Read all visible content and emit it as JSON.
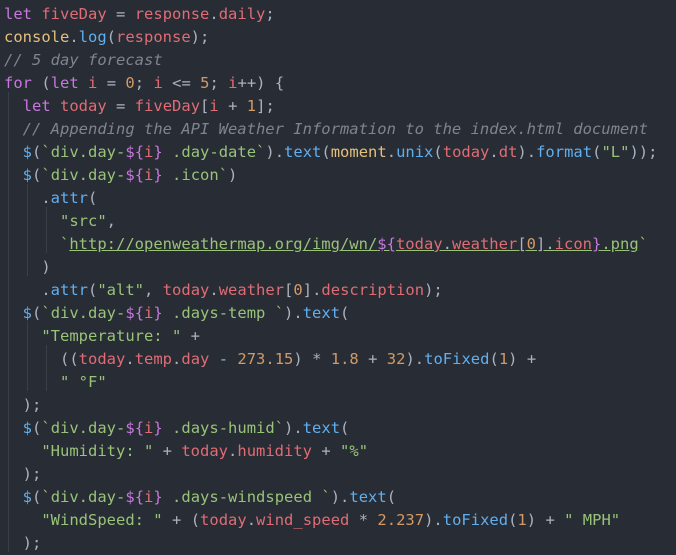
{
  "editor": {
    "theme": "dark",
    "background": "#282c34",
    "lines": [
      "let fiveDay = response.daily;",
      "console.log(response);",
      "// 5 day forecast",
      "for (let i = 0; i <= 5; i++) {",
      "  let today = fiveDay[i + 1];",
      "  // Appending the API Weather Information to the index.html document",
      "  $(`div.day-${i} .day-date`).text(moment.unix(today.dt).format(\"L\"));",
      "  $(`div.day-${i} .icon`)",
      "    .attr(",
      "      \"src\",",
      "      `http://openweathermap.org/img/wn/${today.weather[0].icon}.png`",
      "    )",
      "    .attr(\"alt\", today.weather[0].description);",
      "  $(`div.day-${i} .days-temp `).text(",
      "    \"Temperature: \" +",
      "      ((today.temp.day - 273.15) * 1.8 + 32).toFixed(1) +",
      "      \" °F\"",
      "  );",
      "  $(`div.day-${i} .days-humid`).text(",
      "    \"Humidity: \" + today.humidity + \"%\"",
      "  );",
      "  $(`div.day-${i} .days-windspeed `).text(",
      "    \"WindSpeed: \" + (today.wind_speed * 2.237).toFixed(1) + \" MPH\"",
      "  );"
    ]
  }
}
